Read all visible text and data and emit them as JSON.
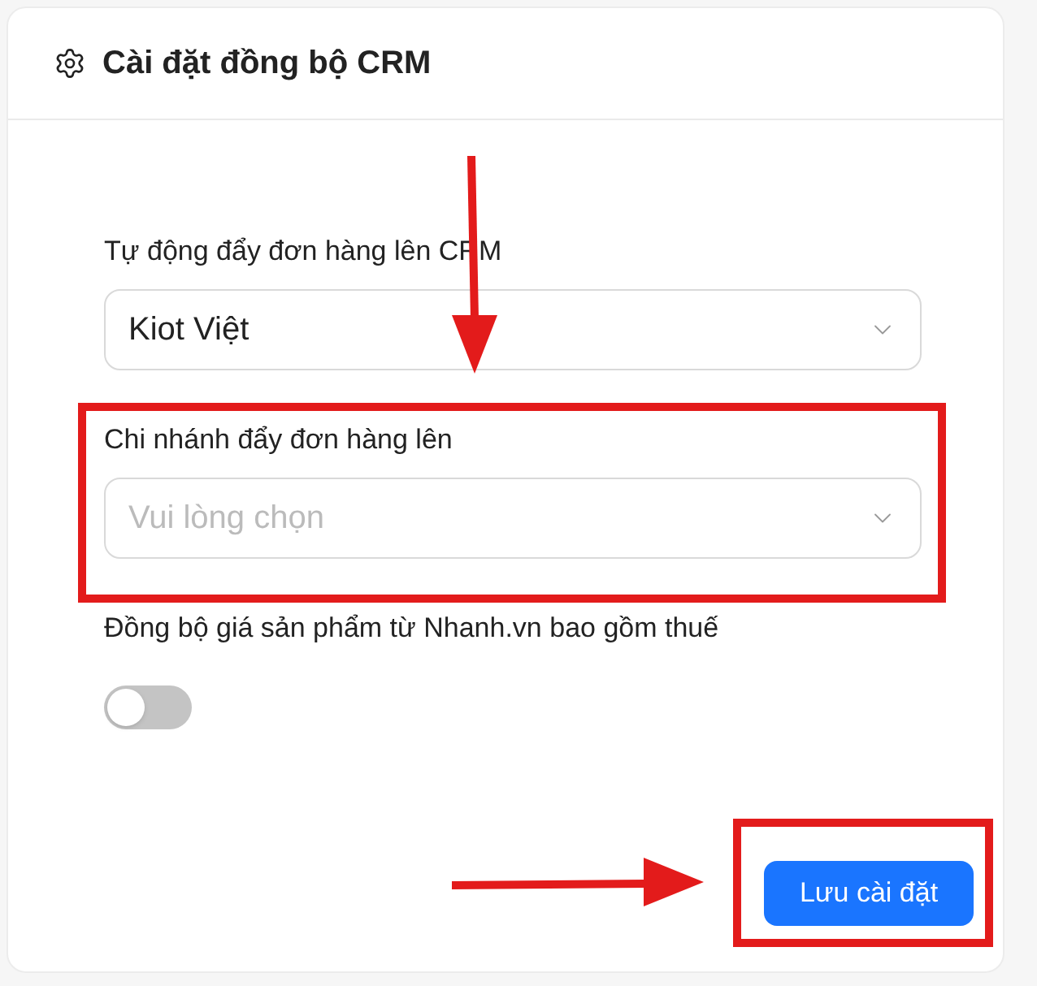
{
  "card": {
    "title": "Cài đặt đồng bộ CRM"
  },
  "fields": [
    {
      "kind": "select",
      "label": "Tự động đẩy đơn hàng lên CRM",
      "value": "Kiot Việt"
    },
    {
      "kind": "select",
      "label": "Chi nhánh đẩy đơn hàng lên",
      "placeholder": "Vui lòng chọn"
    },
    {
      "kind": "switch",
      "label": "Đồng bộ giá sản phẩm từ Nhanh.vn bao gồm thuế",
      "on": false
    }
  ],
  "save_button": {
    "label": "Lưu cài đặt"
  }
}
